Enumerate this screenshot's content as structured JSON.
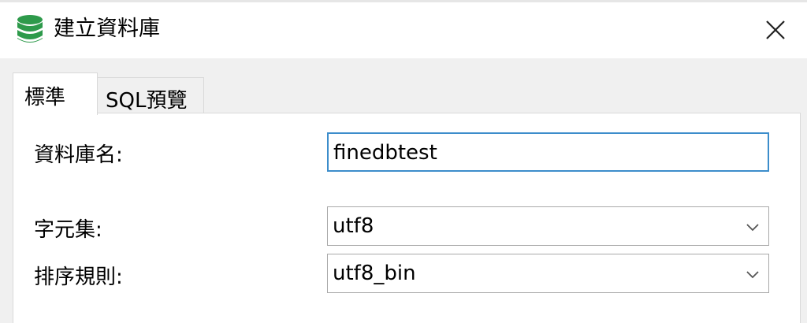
{
  "window": {
    "title": "建立資料庫",
    "icon": "database-icon",
    "close_icon": "close-icon"
  },
  "tabs": [
    {
      "label": "標準",
      "active": true
    },
    {
      "label": "SQL預覽",
      "active": false
    }
  ],
  "form": {
    "db_name_label": "資料庫名:",
    "db_name_value": "finedbtest",
    "charset_label": "字元集:",
    "charset_value": "utf8",
    "collation_label": "排序規則:",
    "collation_value": "utf8_bin"
  },
  "colors": {
    "icon_green": "#2e9a4b",
    "focus_border": "#3c8dcb"
  }
}
